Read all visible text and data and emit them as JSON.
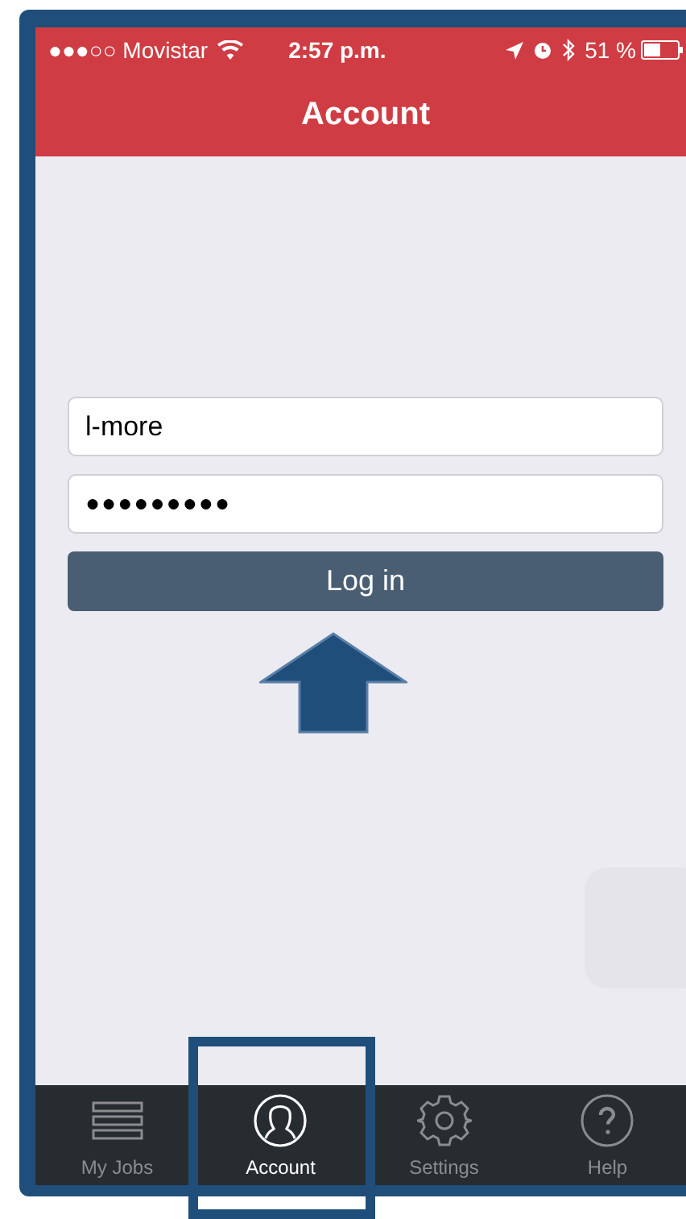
{
  "status_bar": {
    "carrier": "●●●○○ Movistar",
    "time": "2:57 p.m.",
    "battery": "51 %",
    "battery_meter": {
      "level": 0.51
    }
  },
  "nav_bar": {
    "title": "Account"
  },
  "login_form": {
    "username": "l-more",
    "password": "●●●●●●●●●",
    "button": "Log in"
  },
  "tab_bar": [
    {
      "label": "My Jobs",
      "kind": "list",
      "selected": false
    },
    {
      "label": "Account",
      "kind": "person",
      "selected": true
    },
    {
      "label": "Settings",
      "kind": "gear",
      "selected": false
    },
    {
      "label": "Help",
      "kind": "help",
      "selected": false
    }
  ]
}
